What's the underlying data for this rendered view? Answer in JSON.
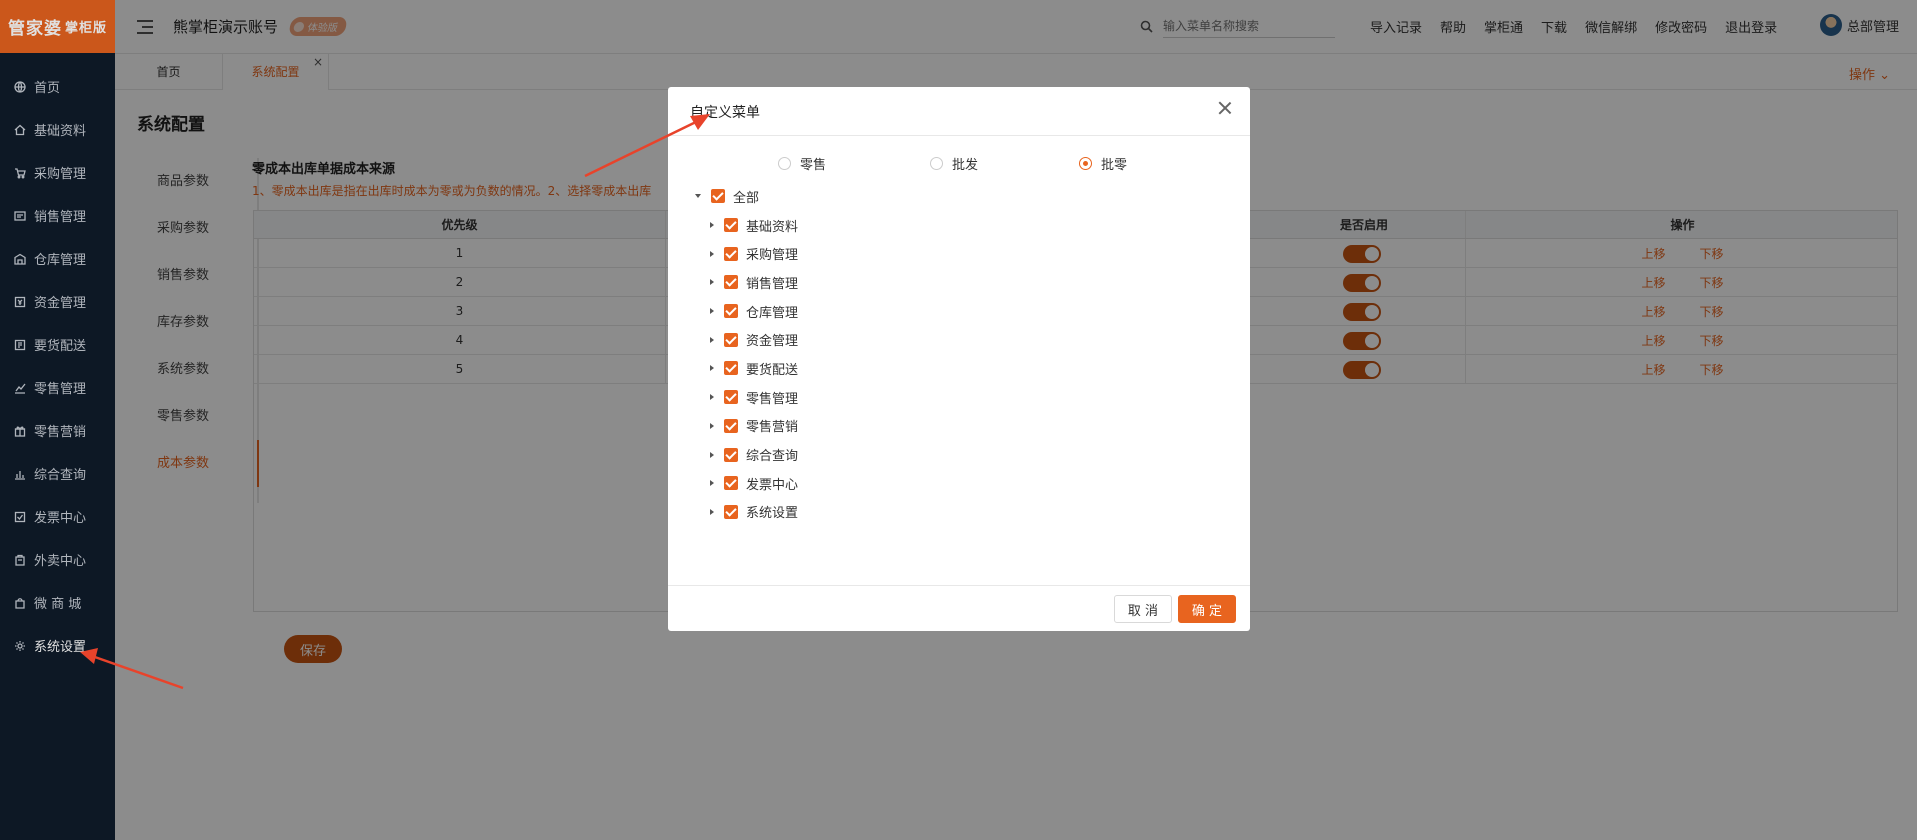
{
  "brand": {
    "logo_main": "管家婆",
    "logo_sub": "掌柜版"
  },
  "sidebar": {
    "items": [
      {
        "label": "首页",
        "icon": "globe-icon"
      },
      {
        "label": "基础资料",
        "icon": "home-icon"
      },
      {
        "label": "采购管理",
        "icon": "cart-icon"
      },
      {
        "label": "销售管理",
        "icon": "sales-icon"
      },
      {
        "label": "仓库管理",
        "icon": "warehouse-icon"
      },
      {
        "label": "资金管理",
        "icon": "money-icon"
      },
      {
        "label": "要货配送",
        "icon": "delivery-icon"
      },
      {
        "label": "零售管理",
        "icon": "chart-icon"
      },
      {
        "label": "零售营销",
        "icon": "gift-icon"
      },
      {
        "label": "综合查询",
        "icon": "bar-chart-icon"
      },
      {
        "label": "发票中心",
        "icon": "invoice-icon"
      },
      {
        "label": "外卖中心",
        "icon": "takeout-icon"
      },
      {
        "label": "微 商 城",
        "icon": "shop-icon"
      },
      {
        "label": "系统设置",
        "icon": "gear-icon"
      }
    ]
  },
  "header": {
    "account": "熊掌柜演示账号",
    "badge": "体验版",
    "search_placeholder": "输入菜单名称搜索",
    "links": [
      "导入记录",
      "帮助",
      "掌柜通",
      "下载",
      "微信解绑",
      "修改密码",
      "退出登录"
    ],
    "user": "总部管理"
  },
  "tabs": {
    "home": "首页",
    "active": "系统配置",
    "close": "×",
    "ops": "操作 ⌄"
  },
  "page": {
    "title": "系统配置",
    "subnav": [
      "商品参数",
      "采购参数",
      "销售参数",
      "库存参数",
      "系统参数",
      "零售参数",
      "成本参数"
    ],
    "section_title": "零成本出库单据成本来源",
    "section_desc": "1、零成本出库是指在出库时成本为零或为负数的情况。2、选择零成本出库",
    "table": {
      "headers": {
        "priority": "优先级",
        "enabled": "是否启用",
        "actions": "操作"
      },
      "rows": [
        {
          "priority": "1",
          "enabled": true
        },
        {
          "priority": "2",
          "enabled": true
        },
        {
          "priority": "3",
          "enabled": true
        },
        {
          "priority": "4",
          "enabled": true
        },
        {
          "priority": "5",
          "enabled": true
        }
      ],
      "up": "上移",
      "down": "下移"
    },
    "save": "保存"
  },
  "modal": {
    "title": "自定义菜单",
    "radios": [
      {
        "label": "零售",
        "checked": false
      },
      {
        "label": "批发",
        "checked": false
      },
      {
        "label": "批零",
        "checked": true
      }
    ],
    "root": "全部",
    "children": [
      "基础资料",
      "采购管理",
      "销售管理",
      "仓库管理",
      "资金管理",
      "要货配送",
      "零售管理",
      "零售营销",
      "综合查询",
      "发票中心",
      "系统设置"
    ],
    "cancel": "取 消",
    "ok": "确 定"
  },
  "colors": {
    "accent": "#e8641f",
    "sidebar_bg": "#0f1c2b",
    "annotation_arrow": "#e8432b"
  }
}
